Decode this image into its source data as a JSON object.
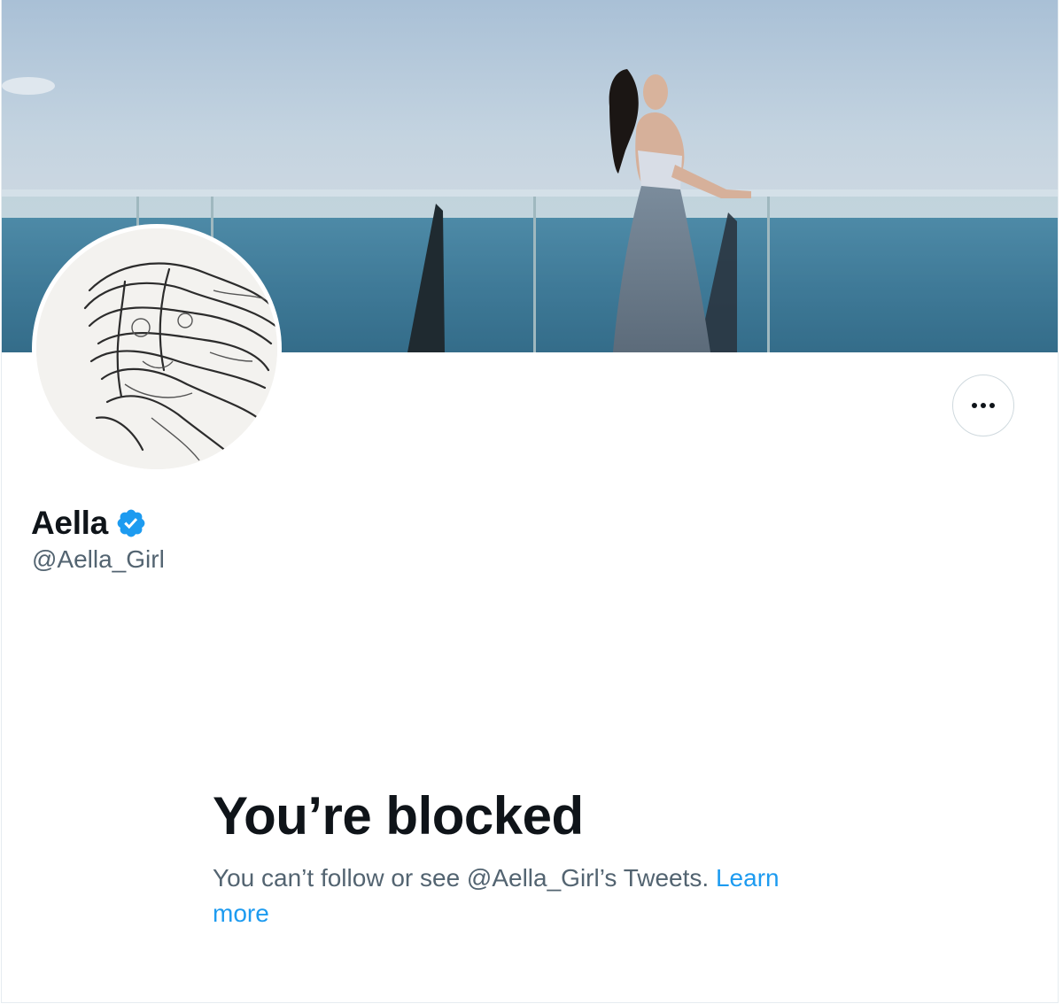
{
  "profile": {
    "display_name": "Aella",
    "handle": "@Aella_Girl",
    "verified": true
  },
  "blocked": {
    "title": "You’re blocked",
    "message": "You can’t follow or see @Aella_Girl’s Tweets. ",
    "link_label": "Learn more"
  },
  "icons": {
    "verified": "verified-badge-icon",
    "more": "more-horizontal-icon"
  },
  "colors": {
    "accent": "#1d9bf0",
    "text_primary": "#0f1419",
    "text_secondary": "#536471",
    "border": "#cfd9de"
  }
}
